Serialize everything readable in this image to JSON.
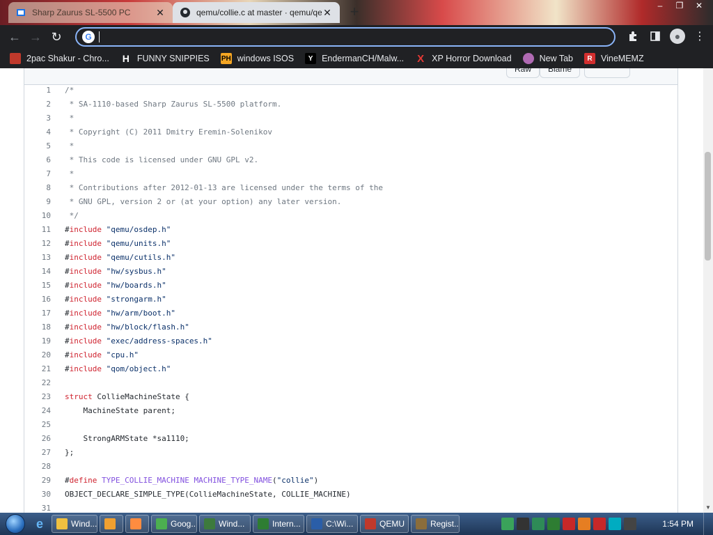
{
  "browser": {
    "tabs": [
      {
        "title": "Sharp Zaurus SL-5500 PC",
        "close": "✕"
      },
      {
        "title": "qemu/collie.c at master · qemu/qemu",
        "close": "✕"
      }
    ],
    "new_tab": "+",
    "omnibox": {
      "value": "",
      "placeholder": ""
    },
    "window_controls": [
      "–",
      "❐",
      "✕"
    ]
  },
  "bookmarks": [
    {
      "label": "2pac Shakur - Chro...",
      "icon_color": "#e8e8e8"
    },
    {
      "label": "FUNNY SNIPPIES",
      "icon_text": "H",
      "icon_color": "#ffffff"
    },
    {
      "label": "windows ISOS",
      "icon_text": "PH",
      "icon_color": "#f5a623"
    },
    {
      "label": "EndermanCH/Malw...",
      "icon_text": "Y",
      "icon_color": "#ffffff"
    },
    {
      "label": "XP Horror Download",
      "icon_text": "X",
      "icon_color": "#e53935"
    },
    {
      "label": "New Tab",
      "icon_color": "#b06ab3"
    },
    {
      "label": "VineMEMZ",
      "icon_text": "R",
      "icon_color": "#d32f2f"
    }
  ],
  "file_header": {
    "raw": "Raw",
    "blame": "Blame"
  },
  "code": [
    {
      "n": "1",
      "parts": [
        {
          "c": "cm",
          "t": "/*"
        }
      ]
    },
    {
      "n": "2",
      "parts": [
        {
          "c": "cm",
          "t": " * SA-1110-based Sharp Zaurus SL-5500 platform."
        }
      ]
    },
    {
      "n": "3",
      "parts": [
        {
          "c": "cm",
          "t": " *"
        }
      ]
    },
    {
      "n": "4",
      "parts": [
        {
          "c": "cm",
          "t": " * Copyright (C) 2011 Dmitry Eremin-Solenikov"
        }
      ]
    },
    {
      "n": "5",
      "parts": [
        {
          "c": "cm",
          "t": " *"
        }
      ]
    },
    {
      "n": "6",
      "parts": [
        {
          "c": "cm",
          "t": " * This code is licensed under GNU GPL v2."
        }
      ]
    },
    {
      "n": "7",
      "parts": [
        {
          "c": "cm",
          "t": " *"
        }
      ]
    },
    {
      "n": "8",
      "parts": [
        {
          "c": "cm",
          "t": " * Contributions after 2012-01-13 are licensed under the terms of the"
        }
      ]
    },
    {
      "n": "9",
      "parts": [
        {
          "c": "cm",
          "t": " * GNU GPL, version 2 or (at your option) any later version."
        }
      ]
    },
    {
      "n": "10",
      "parts": [
        {
          "c": "cm",
          "t": " */"
        }
      ]
    },
    {
      "n": "11",
      "parts": [
        {
          "c": "id",
          "t": "#"
        },
        {
          "c": "kw",
          "t": "include"
        },
        {
          "c": "str",
          "t": " \"qemu/osdep.h\""
        }
      ]
    },
    {
      "n": "12",
      "parts": [
        {
          "c": "id",
          "t": "#"
        },
        {
          "c": "kw",
          "t": "include"
        },
        {
          "c": "str",
          "t": " \"qemu/units.h\""
        }
      ]
    },
    {
      "n": "13",
      "parts": [
        {
          "c": "id",
          "t": "#"
        },
        {
          "c": "kw",
          "t": "include"
        },
        {
          "c": "str",
          "t": " \"qemu/cutils.h\""
        }
      ]
    },
    {
      "n": "14",
      "parts": [
        {
          "c": "id",
          "t": "#"
        },
        {
          "c": "kw",
          "t": "include"
        },
        {
          "c": "str",
          "t": " \"hw/sysbus.h\""
        }
      ]
    },
    {
      "n": "15",
      "parts": [
        {
          "c": "id",
          "t": "#"
        },
        {
          "c": "kw",
          "t": "include"
        },
        {
          "c": "str",
          "t": " \"hw/boards.h\""
        }
      ]
    },
    {
      "n": "16",
      "parts": [
        {
          "c": "id",
          "t": "#"
        },
        {
          "c": "kw",
          "t": "include"
        },
        {
          "c": "str",
          "t": " \"strongarm.h\""
        }
      ]
    },
    {
      "n": "17",
      "parts": [
        {
          "c": "id",
          "t": "#"
        },
        {
          "c": "kw",
          "t": "include"
        },
        {
          "c": "str",
          "t": " \"hw/arm/boot.h\""
        }
      ]
    },
    {
      "n": "18",
      "parts": [
        {
          "c": "id",
          "t": "#"
        },
        {
          "c": "kw",
          "t": "include"
        },
        {
          "c": "str",
          "t": " \"hw/block/flash.h\""
        }
      ]
    },
    {
      "n": "19",
      "parts": [
        {
          "c": "id",
          "t": "#"
        },
        {
          "c": "kw",
          "t": "include"
        },
        {
          "c": "str",
          "t": " \"exec/address-spaces.h\""
        }
      ]
    },
    {
      "n": "20",
      "parts": [
        {
          "c": "id",
          "t": "#"
        },
        {
          "c": "kw",
          "t": "include"
        },
        {
          "c": "str",
          "t": " \"cpu.h\""
        }
      ]
    },
    {
      "n": "21",
      "parts": [
        {
          "c": "id",
          "t": "#"
        },
        {
          "c": "kw",
          "t": "include"
        },
        {
          "c": "str",
          "t": " \"qom/object.h\""
        }
      ]
    },
    {
      "n": "22",
      "parts": []
    },
    {
      "n": "23",
      "parts": [
        {
          "c": "kw",
          "t": "struct"
        },
        {
          "c": "id",
          "t": " CollieMachineState {"
        }
      ]
    },
    {
      "n": "24",
      "parts": [
        {
          "c": "id",
          "t": "    MachineState parent;"
        }
      ]
    },
    {
      "n": "25",
      "parts": []
    },
    {
      "n": "26",
      "parts": [
        {
          "c": "id",
          "t": "    StrongARMState *sa1110;"
        }
      ]
    },
    {
      "n": "27",
      "parts": [
        {
          "c": "id",
          "t": "};"
        }
      ]
    },
    {
      "n": "28",
      "parts": []
    },
    {
      "n": "29",
      "parts": [
        {
          "c": "id",
          "t": "#"
        },
        {
          "c": "kw",
          "t": "define"
        },
        {
          "c": "pp",
          "t": " TYPE_COLLIE_MACHINE MACHINE_TYPE_NAME"
        },
        {
          "c": "id",
          "t": "("
        },
        {
          "c": "str",
          "t": "\"collie\""
        },
        {
          "c": "id",
          "t": ")"
        }
      ]
    },
    {
      "n": "30",
      "parts": [
        {
          "c": "id",
          "t": "OBJECT_DECLARE_SIMPLE_TYPE(CollieMachineState, COLLIE_MACHINE)"
        }
      ]
    },
    {
      "n": "31",
      "parts": []
    }
  ],
  "taskbar": {
    "tasks": [
      {
        "label": "Wind...",
        "color": "#f0c040"
      },
      {
        "label": "",
        "color": "#f0a030"
      },
      {
        "label": "",
        "color": "#ff8c40"
      },
      {
        "label": "Goog...",
        "color": "#4caf50"
      },
      {
        "label": "Wind...",
        "color": "#3d7a3d"
      },
      {
        "label": "Intern...",
        "color": "#2e7d32"
      },
      {
        "label": "C:\\Wi...",
        "color": "#2a5ea8"
      },
      {
        "label": "QEMU",
        "color": "#c0392b"
      },
      {
        "label": "Regist...",
        "color": "#8a6d3b"
      }
    ],
    "clock": "1:54 PM",
    "tray_colors": [
      "#3aa35a",
      "#333333",
      "#2e8b57",
      "#2e7d32",
      "#c62828",
      "#e67e22",
      "#c62828",
      "#00acc1",
      "#444444"
    ]
  }
}
